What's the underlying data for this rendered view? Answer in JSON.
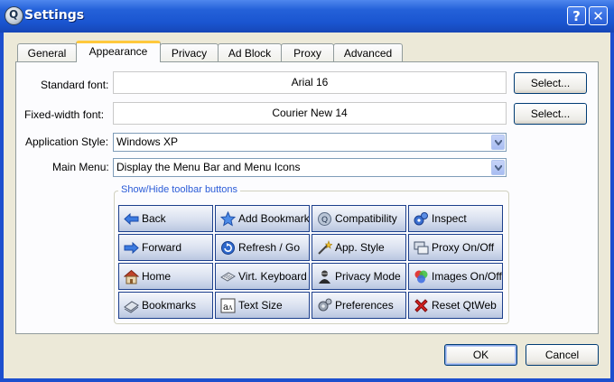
{
  "window": {
    "title": "Settings",
    "help_label": "?",
    "close_label": "✕"
  },
  "tabs": [
    {
      "label": "General"
    },
    {
      "label": "Appearance"
    },
    {
      "label": "Privacy"
    },
    {
      "label": "Ad Block"
    },
    {
      "label": "Proxy"
    },
    {
      "label": "Advanced"
    }
  ],
  "form": {
    "standard_font_label": "Standard font:",
    "standard_font_value": "Arial 16",
    "fixed_font_label": "Fixed-width font:",
    "fixed_font_value": "Courier New 14",
    "select_label": "Select...",
    "app_style_label": "Application Style:",
    "app_style_value": "Windows XP",
    "main_menu_label": "Main Menu:",
    "main_menu_value": "Display the Menu Bar and Menu Icons"
  },
  "toolbar_group": {
    "title": "Show/Hide toolbar buttons",
    "buttons": [
      {
        "label": "Back",
        "icon": "back-arrow-icon"
      },
      {
        "label": "Add Bookmark",
        "icon": "star-icon"
      },
      {
        "label": "Compatibility",
        "icon": "compatibility-icon"
      },
      {
        "label": "Inspect",
        "icon": "gears-icon"
      },
      {
        "label": "Forward",
        "icon": "forward-arrow-icon"
      },
      {
        "label": "Refresh / Go",
        "icon": "refresh-icon"
      },
      {
        "label": "App. Style",
        "icon": "magic-wand-icon"
      },
      {
        "label": "Proxy On/Off",
        "icon": "proxy-icon"
      },
      {
        "label": "Home",
        "icon": "home-icon"
      },
      {
        "label": "Virt. Keyboard",
        "icon": "keyboard-icon"
      },
      {
        "label": "Privacy Mode",
        "icon": "incognito-icon"
      },
      {
        "label": "Images On/Off",
        "icon": "color-wheel-icon"
      },
      {
        "label": "Bookmarks",
        "icon": "bookmarks-icon"
      },
      {
        "label": "Text Size",
        "icon": "text-size-icon"
      },
      {
        "label": "Preferences",
        "icon": "preferences-icon"
      },
      {
        "label": "Reset QtWeb",
        "icon": "red-x-icon"
      }
    ]
  },
  "footer": {
    "ok_label": "OK",
    "cancel_label": "Cancel"
  },
  "colors": {
    "titlebar": "#2461d9",
    "dialog_bg": "#ece9d8",
    "tab_highlight": "#ffc83c",
    "group_title": "#2a5bd7"
  }
}
